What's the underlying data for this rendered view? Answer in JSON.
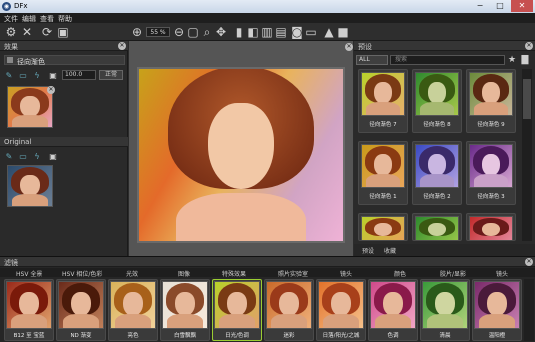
{
  "window": {
    "title": "DFx",
    "min": "−",
    "max": "□",
    "close": "✕"
  },
  "menu": [
    "文件",
    "编辑",
    "查看",
    "帮助"
  ],
  "toolbar": {
    "zoom": "55 %"
  },
  "left": {
    "effects_title": "效果",
    "layer_label": "径向渐色",
    "opacity": "100.0",
    "mode": "正常",
    "original_title": "Original"
  },
  "right": {
    "presets_title": "预设",
    "category": "ALL",
    "search_placeholder": "搜索",
    "presets": [
      "径向渐色 7",
      "径向渐色 8",
      "径向渐色 9",
      "径向渐色 1",
      "径向渐色 2",
      "径向渐色 3",
      "",
      "",
      ""
    ],
    "tabs": [
      "预设",
      "收藏"
    ]
  },
  "bottom": {
    "title": "滤镜",
    "categories": [
      "HSV 全景",
      "HSV 相位/色彩",
      "光效",
      "图像",
      "特殊效果",
      "照片实验室",
      "镜头",
      "颜色",
      "胶片/显影",
      "镜头"
    ],
    "thumbs": [
      "B12 至 宝蓝",
      "ND 渐变",
      "亮色",
      "白雪飘飘",
      "日光/色调",
      "迷彩",
      "日落/阳光/之城",
      "色调",
      "清晨",
      "温阳橙"
    ]
  },
  "colors": {
    "accent": "#9acd32",
    "bg": "#2b2b2b"
  }
}
